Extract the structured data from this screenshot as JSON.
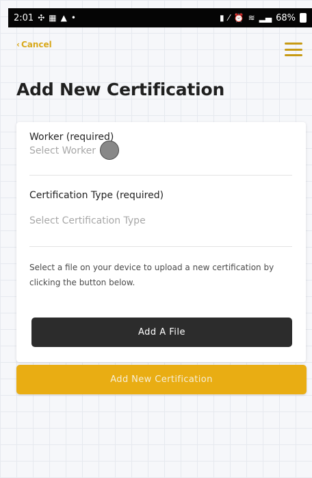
{
  "status_bar": {
    "time": "2:01",
    "battery_percent": "68%"
  },
  "header": {
    "cancel_label": "Cancel",
    "page_title": "Add New Certification"
  },
  "form": {
    "worker": {
      "label": "Worker (required)",
      "placeholder": "Select Worker"
    },
    "certification_type": {
      "label": "Certification Type (required)",
      "placeholder": "Select Certification Type"
    },
    "help_text": "Select a file on your device to upload a new certification by clicking the button below.",
    "add_file_label": "Add A File",
    "submit_label": "Add New Certification"
  },
  "colors": {
    "accent": "#e9ad13",
    "dark_button": "#2c2c2c",
    "cancel_text": "#d9a91c"
  }
}
